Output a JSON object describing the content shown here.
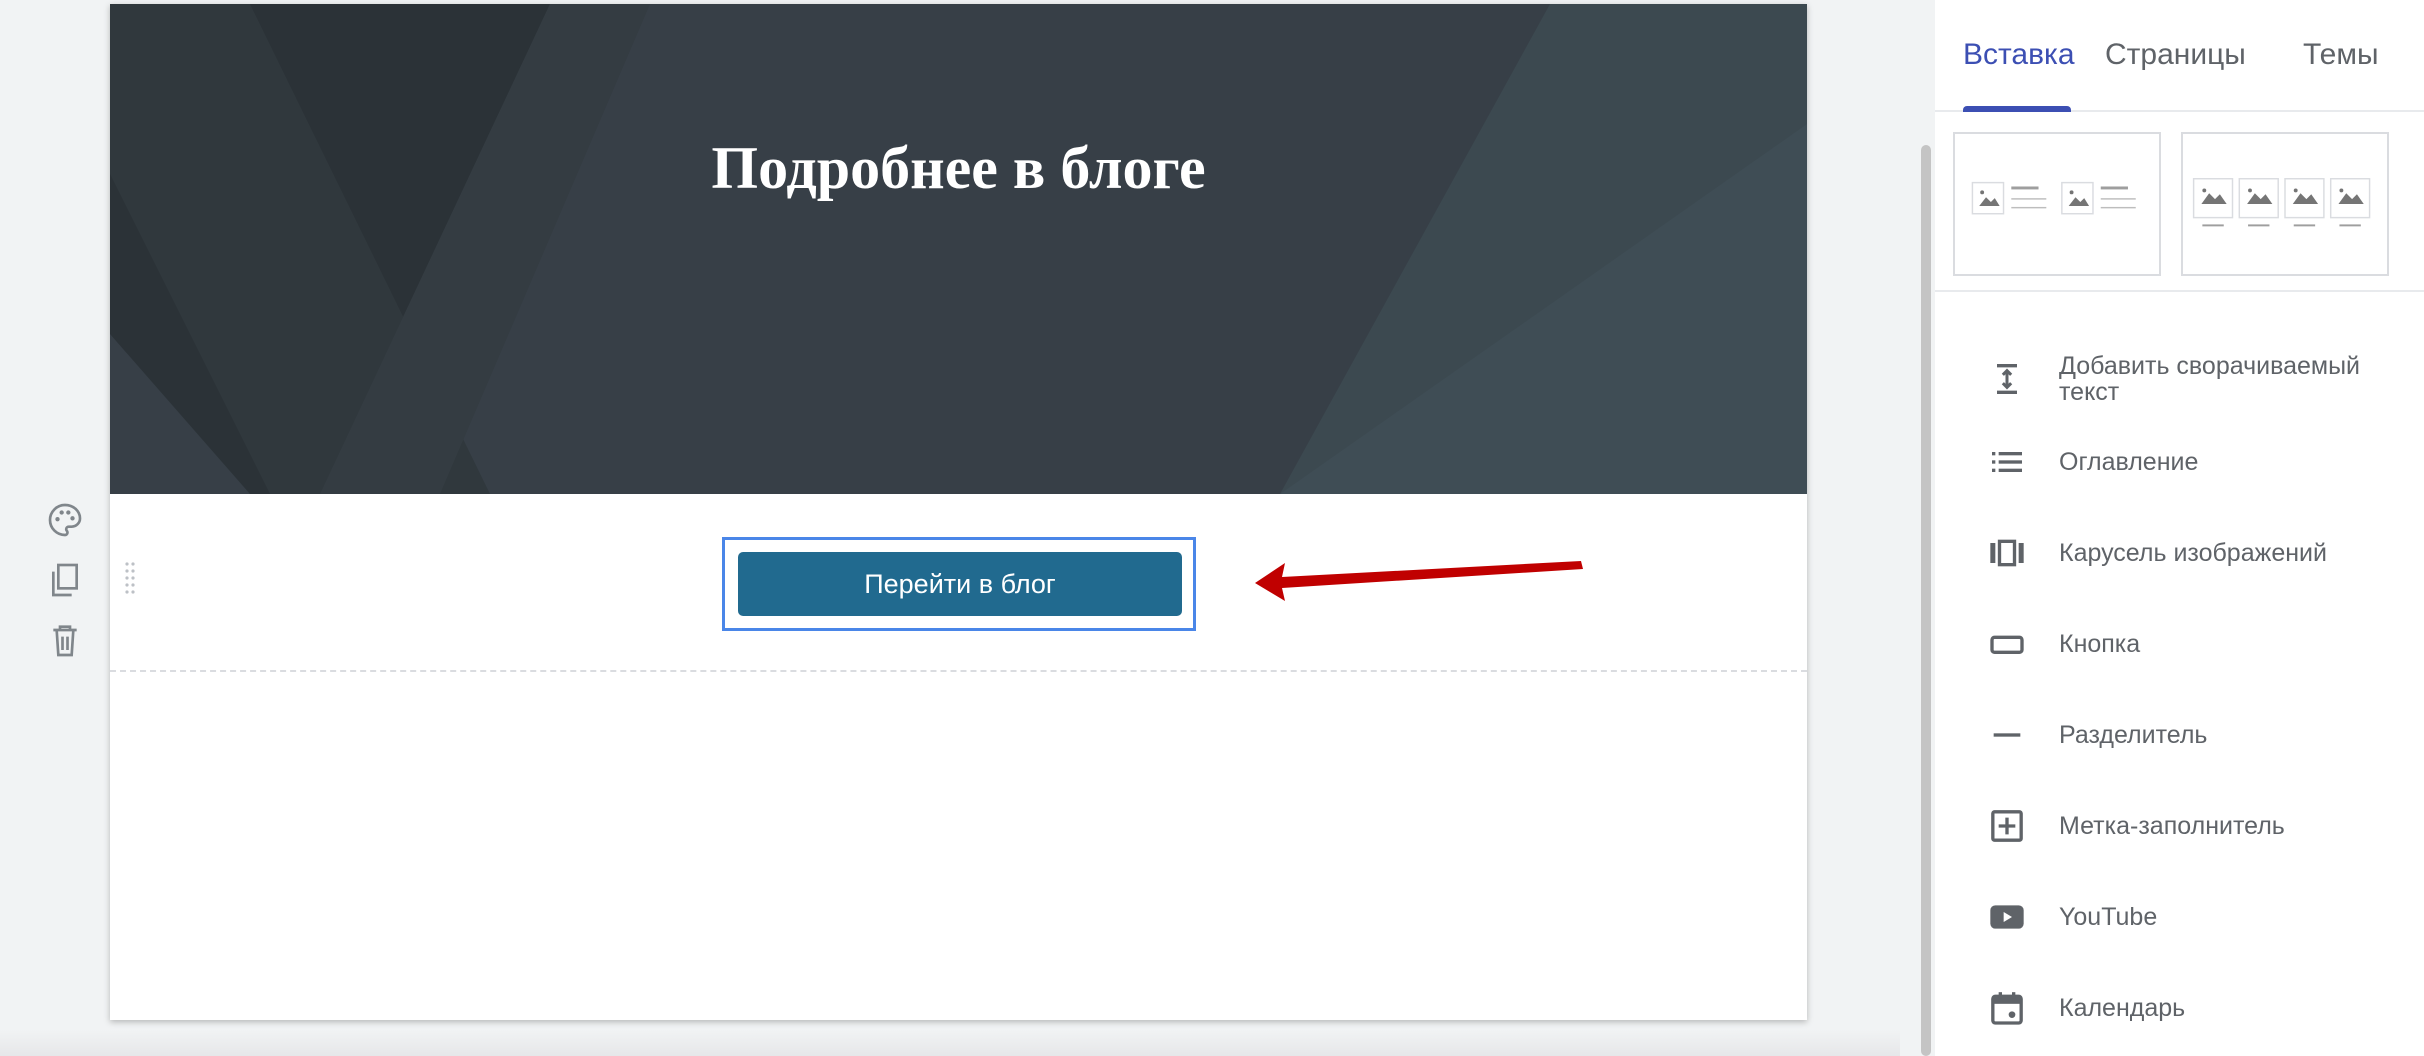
{
  "hero": {
    "title": "Подробнее в блоге"
  },
  "section": {
    "button_label": "Перейти в блог"
  },
  "section_tools": [
    {
      "name": "palette-icon",
      "label": "Section background"
    },
    {
      "name": "duplicate-icon",
      "label": "Duplicate section"
    },
    {
      "name": "delete-icon",
      "label": "Delete section"
    }
  ],
  "sidebar": {
    "tabs": [
      {
        "label": "Вставка",
        "active": true
      },
      {
        "label": "Страницы",
        "active": false
      },
      {
        "label": "Темы",
        "active": false
      }
    ],
    "layouts": [
      {
        "name": "layout-two-images-text"
      },
      {
        "name": "layout-four-images"
      }
    ],
    "insert_items": [
      {
        "icon": "collapsible-text-icon",
        "label": "Добавить сворачиваемый текст"
      },
      {
        "icon": "table-of-contents-icon",
        "label": "Оглавление"
      },
      {
        "icon": "image-carousel-icon",
        "label": "Карусель изображений"
      },
      {
        "icon": "button-icon",
        "label": "Кнопка"
      },
      {
        "icon": "divider-icon",
        "label": "Разделитель"
      },
      {
        "icon": "placeholder-icon",
        "label": "Метка-заполнитель"
      },
      {
        "icon": "youtube-icon",
        "label": "YouTube"
      },
      {
        "icon": "calendar-icon",
        "label": "Календарь"
      }
    ]
  },
  "colors": {
    "accent": "#3c4fb3",
    "button_bg": "#216a8f",
    "selection_frame": "#4a86e8",
    "annotation_arrow": "#c00000",
    "hero_bg": "#363e45"
  }
}
